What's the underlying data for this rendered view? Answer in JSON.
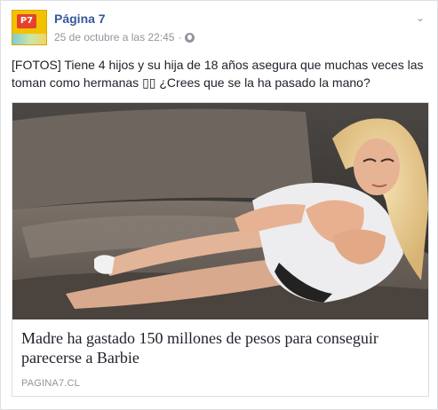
{
  "post": {
    "page_name": "Página 7",
    "timestamp": "25 de octubre a las 22:45",
    "separator": "·",
    "avatar_text": "P7",
    "text": "[FOTOS] Tiene 4 hijos y su hija de 18 años asegura que muchas veces las toman como hermanas ▯▯ ¿Crees que se la ha pasado la mano?"
  },
  "link_preview": {
    "headline": "Madre ha gastado 150 millones de pesos para conseguir parecerse a Barbie",
    "domain": "PAGINA7.CL"
  },
  "icons": {
    "privacy": "globe-icon",
    "options": "chevron-down-icon"
  },
  "colors": {
    "page_name": "#365899",
    "meta": "#90949c",
    "text": "#1d2129",
    "border": "#dddfe2"
  }
}
